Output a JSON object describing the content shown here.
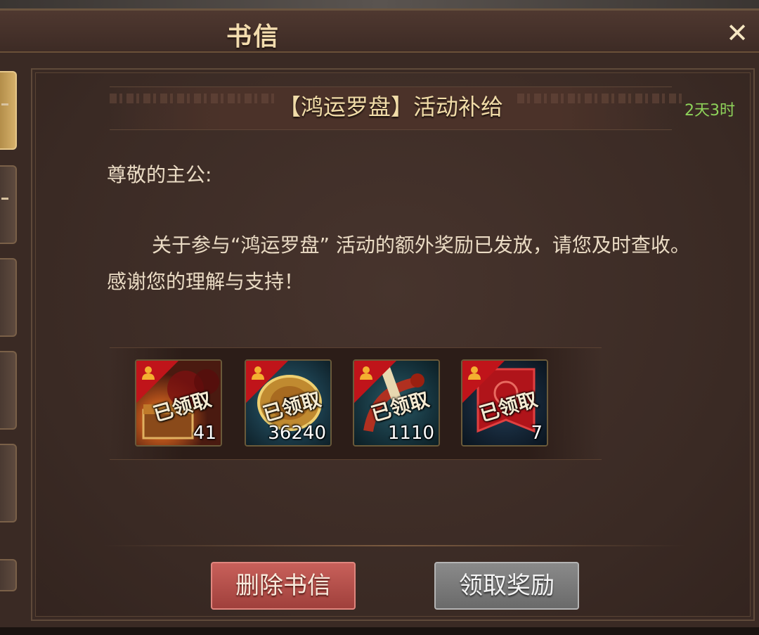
{
  "window": {
    "title": "书信",
    "close_icon": "close-icon"
  },
  "mail": {
    "title": "【鸿运罗盘】活动补给",
    "time_left": "2天3时",
    "greeting": "尊敬的主公:",
    "body": "关于参与“鸿运罗盘” 活动的额外奖励已发放，请您及时查收。感谢您的理解与支持！"
  },
  "rewards": [
    {
      "icon": "treasure-chest-icon",
      "status": "已领取",
      "count": "41"
    },
    {
      "icon": "gold-coin-icon",
      "status": "已领取",
      "count": "36240"
    },
    {
      "icon": "scroll-icon",
      "status": "已领取",
      "count": "1110"
    },
    {
      "icon": "red-banner-icon",
      "status": "已领取",
      "count": "7"
    }
  ],
  "buttons": {
    "delete": "删除书信",
    "claim": "领取奖励"
  },
  "colors": {
    "time_left": "#8ed35a",
    "title_gold": "#f1dca8",
    "delete_red": "#b0504a",
    "claim_gray": "#7a7a7a",
    "corner_red": "#c0141a"
  }
}
